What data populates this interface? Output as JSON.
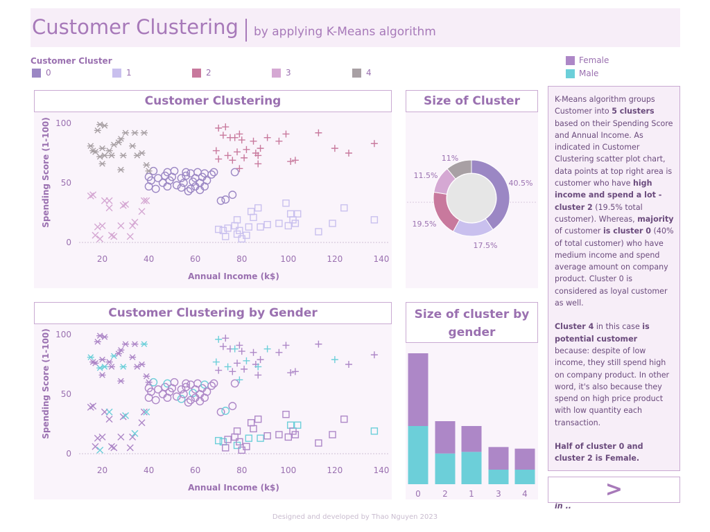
{
  "header": {
    "title": "Customer Clustering",
    "subtitle": "by applying K-Means algorithm"
  },
  "cluster_legend": {
    "title": "Customer Cluster",
    "items": [
      {
        "label": "0",
        "color": "#9b87c4"
      },
      {
        "label": "1",
        "color": "#c9c0ee"
      },
      {
        "label": "2",
        "color": "#c8799d"
      },
      {
        "label": "3",
        "color": "#d5a8d3"
      },
      {
        "label": "4",
        "color": "#a8a0a4"
      }
    ]
  },
  "gender_legend": [
    {
      "label": "Female",
      "color": "#ad87c7"
    },
    {
      "label": "Male",
      "color": "#6ccfd9"
    }
  ],
  "panels": {
    "scatter1_title": "Customer Clustering",
    "donut_title": "Size of Cluster",
    "scatter2_title": "Customer Clustering by Gender",
    "bars_title_line1": "Size of cluster by",
    "bars_title_line2": "gender"
  },
  "sidebar": {
    "p1_a": "K-Means algorithm groups Customer into ",
    "p1_b": "5 clusters",
    "p1_c": " based on their Spending Score and Annual Income. As indicated in Customer Clustering scatter plot chart, data points at top right area is customer who have ",
    "p1_d": "high income and spend a lot - cluster 2",
    "p1_e": " (19.5% total customer). Whereas, ",
    "p1_f": "majority",
    "p1_g": " of customer ",
    "p1_h": "is cluster 0",
    "p1_i": " (40% of total customer) who have medium income and spend average amount on company product. Cluster 0 is considered as loyal customer as well.",
    "p2_a": "Cluster 4",
    "p2_b": " in this case ",
    "p2_c": "is potential customer",
    "p2_d": " because: despite of low income, they still spend high on company product. In other word, it's also because they spend on high price product with low quantity each transaction.",
    "p3": "Half of cluster 0 and cluster 2 is Female.",
    "p4": "Click \">\" next page to see which Age is most common in .."
  },
  "next_button": ">",
  "footer": "Designed and developed by Thao Nguyen 2023",
  "chart_data": [
    {
      "type": "scatter",
      "title": "Customer Clustering",
      "xlabel": "Annual Income (k$)",
      "ylabel": "Spending Score (1-100)",
      "xlim": [
        10,
        143
      ],
      "ylim": [
        0,
        100
      ],
      "xticks": [
        20,
        40,
        60,
        80,
        100,
        120,
        140
      ],
      "yticks": [
        0,
        50,
        100
      ],
      "clusters": [
        {
          "name": "0",
          "marker": "circle",
          "points": [
            [
              40,
              47
            ],
            [
              40,
              55
            ],
            [
              41,
              52
            ],
            [
              42,
              60
            ],
            [
              43,
              45
            ],
            [
              44,
              54
            ],
            [
              46,
              50
            ],
            [
              47,
              56
            ],
            [
              48,
              47
            ],
            [
              48,
              59
            ],
            [
              49,
              52
            ],
            [
              50,
              55
            ],
            [
              51,
              60
            ],
            [
              52,
              48
            ],
            [
              54,
              46
            ],
            [
              54,
              54
            ],
            [
              55,
              50
            ],
            [
              56,
              56
            ],
            [
              57,
              43
            ],
            [
              58,
              58
            ],
            [
              59,
              51
            ],
            [
              60,
              47
            ],
            [
              60,
              54
            ],
            [
              61,
              59
            ],
            [
              62,
              44
            ],
            [
              62,
              50
            ],
            [
              63,
              55
            ],
            [
              64,
              58
            ],
            [
              64,
              47
            ],
            [
              65,
              52
            ],
            [
              67,
              57
            ],
            [
              68,
              59
            ],
            [
              71,
              35
            ],
            [
              73,
              36
            ],
            [
              76,
              40
            ],
            [
              77,
              59
            ],
            [
              56,
              59
            ],
            [
              58,
              45
            ]
          ]
        },
        {
          "name": "1",
          "marker": "square",
          "points": [
            [
              70,
              11
            ],
            [
              72,
              10
            ],
            [
              73,
              5
            ],
            [
              74,
              12
            ],
            [
              77,
              14
            ],
            [
              78,
              19
            ],
            [
              78,
              7
            ],
            [
              79,
              10
            ],
            [
              80,
              3
            ],
            [
              82,
              6
            ],
            [
              83,
              13
            ],
            [
              84,
              26
            ],
            [
              85,
              21
            ],
            [
              87,
              29
            ],
            [
              88,
              13
            ],
            [
              91,
              15
            ],
            [
              96,
              16
            ],
            [
              99,
              33
            ],
            [
              100,
              14
            ],
            [
              101,
              24
            ],
            [
              102,
              19
            ],
            [
              103,
              16
            ],
            [
              104,
              24
            ],
            [
              113,
              9
            ],
            [
              119,
              16
            ],
            [
              124,
              29
            ],
            [
              137,
              19
            ]
          ]
        },
        {
          "name": "2",
          "marker": "plus",
          "points": [
            [
              70,
              96
            ],
            [
              72,
              90
            ],
            [
              73,
              97
            ],
            [
              74,
              73
            ],
            [
              75,
              88
            ],
            [
              76,
              69
            ],
            [
              77,
              88
            ],
            [
              78,
              76
            ],
            [
              79,
              91
            ],
            [
              79,
              62
            ],
            [
              80,
              86
            ],
            [
              81,
              71
            ],
            [
              82,
              78
            ],
            [
              85,
              85
            ],
            [
              86,
              75
            ],
            [
              87,
              73
            ],
            [
              87,
              66
            ],
            [
              88,
              79
            ],
            [
              91,
              88
            ],
            [
              96,
              85
            ],
            [
              99,
              91
            ],
            [
              101,
              68
            ],
            [
              103,
              69
            ],
            [
              113,
              92
            ],
            [
              120,
              79
            ],
            [
              126,
              75
            ],
            [
              137,
              83
            ],
            [
              69,
              77
            ],
            [
              70,
              70
            ]
          ]
        },
        {
          "name": "3",
          "marker": "x",
          "points": [
            [
              15,
              39
            ],
            [
              16,
              40
            ],
            [
              17,
              6
            ],
            [
              18,
              13
            ],
            [
              19,
              3
            ],
            [
              20,
              14
            ],
            [
              21,
              35
            ],
            [
              23,
              29
            ],
            [
              23,
              35
            ],
            [
              24,
              6
            ],
            [
              25,
              5
            ],
            [
              28,
              14
            ],
            [
              29,
              31
            ],
            [
              30,
              32
            ],
            [
              32,
              5
            ],
            [
              33,
              14
            ],
            [
              34,
              17
            ],
            [
              37,
              26
            ],
            [
              38,
              35
            ],
            [
              39,
              35
            ]
          ]
        },
        {
          "name": "4",
          "marker": "asterisk",
          "points": [
            [
              15,
              81
            ],
            [
              16,
              77
            ],
            [
              17,
              76
            ],
            [
              18,
              94
            ],
            [
              19,
              72
            ],
            [
              19,
              99
            ],
            [
              20,
              66
            ],
            [
              20,
              79
            ],
            [
              21,
              73
            ],
            [
              21,
              98
            ],
            [
              23,
              77
            ],
            [
              24,
              73
            ],
            [
              25,
              82
            ],
            [
              27,
              84
            ],
            [
              28,
              61
            ],
            [
              28,
              87
            ],
            [
              29,
              73
            ],
            [
              30,
              92
            ],
            [
              33,
              81
            ],
            [
              34,
              92
            ],
            [
              35,
              73
            ],
            [
              37,
              75
            ],
            [
              38,
              92
            ],
            [
              39,
              65
            ],
            [
              40,
              60
            ]
          ]
        }
      ]
    },
    {
      "type": "pie",
      "title": "Size of Cluster",
      "donut": true,
      "slices": [
        {
          "label": "0",
          "value": 40.5,
          "text": "40.5%"
        },
        {
          "label": "1",
          "value": 17.5,
          "text": "17.5%"
        },
        {
          "label": "2",
          "value": 19.5,
          "text": "19.5%"
        },
        {
          "label": "3",
          "value": 11.5,
          "text": "11.5%"
        },
        {
          "label": "4",
          "value": 11,
          "text": "11%"
        }
      ]
    },
    {
      "type": "scatter",
      "title": "Customer Clustering by Gender",
      "xlabel": "Annual Income (k$)",
      "ylabel": "Spending Score (1-100)",
      "xlim": [
        10,
        143
      ],
      "ylim": [
        0,
        100
      ],
      "xticks": [
        20,
        40,
        60,
        80,
        100,
        120,
        140
      ],
      "yticks": [
        0,
        50,
        100
      ],
      "male_clusters": {
        "0": [
          3,
          9,
          14,
          20,
          27,
          33
        ],
        "1": [
          0,
          1,
          6,
          10,
          14,
          19,
          22,
          26
        ],
        "2": [
          0,
          3,
          6,
          9,
          12,
          15,
          18,
          24,
          27
        ],
        "3": [
          4,
          8,
          13,
          16,
          19
        ],
        "4": [
          0,
          4,
          8,
          12,
          16,
          22
        ]
      }
    },
    {
      "type": "bar",
      "title": "Size of cluster by gender",
      "stacked": true,
      "categories": [
        "0",
        "2",
        "1",
        "3",
        "4"
      ],
      "series": [
        {
          "name": "Male",
          "values": [
            36,
            19,
            20,
            9,
            9
          ]
        },
        {
          "name": "Female",
          "values": [
            45,
            20,
            16,
            14,
            13
          ]
        }
      ]
    }
  ]
}
